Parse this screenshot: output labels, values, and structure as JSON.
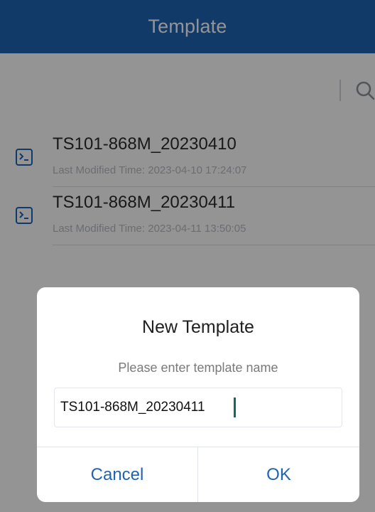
{
  "header": {
    "title": "Template"
  },
  "search": {
    "icon": "search-icon"
  },
  "templates": [
    {
      "name": "TS101-868M_20230410",
      "meta_label": "Last Modified Time: ",
      "modified": "2023-04-10 17:24:07",
      "icon": "terminal-icon"
    },
    {
      "name": "TS101-868M_20230411",
      "meta_label": "Last Modified Time: ",
      "modified": "2023-04-11 13:50:05",
      "icon": "terminal-icon"
    }
  ],
  "dialog": {
    "title": "New Template",
    "prompt": "Please enter template name",
    "input_value": "TS101-868M_20230411",
    "cancel_label": "Cancel",
    "ok_label": "OK"
  },
  "colors": {
    "header_bg": "#1f64b3",
    "accent": "#1f64b3",
    "overlay": "rgba(0,0,0,0.42)",
    "caret": "#0f6b60"
  }
}
